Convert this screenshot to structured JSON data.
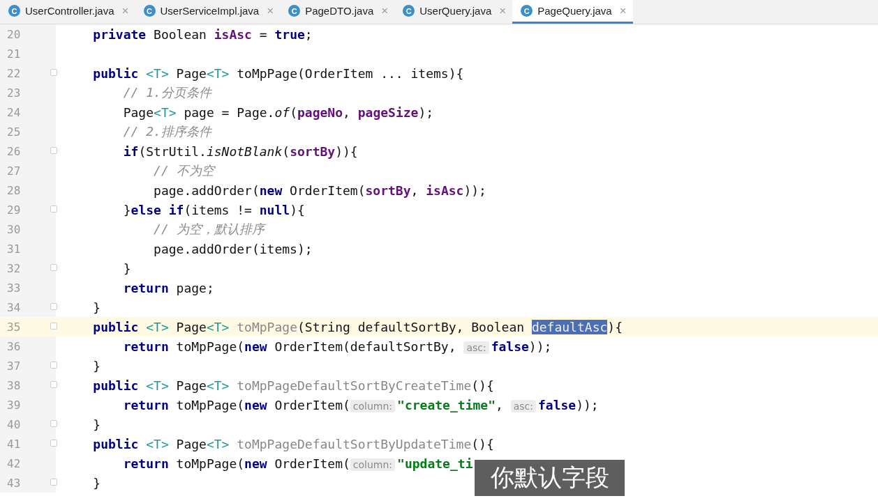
{
  "tabs": [
    {
      "icon": "C",
      "label": "UserController.java",
      "close": "×",
      "selected": false
    },
    {
      "icon": "C",
      "label": "UserServiceImpl.java",
      "close": "×",
      "selected": false
    },
    {
      "icon": "C",
      "label": "PageDTO.java",
      "close": "×",
      "selected": false
    },
    {
      "icon": "C",
      "label": "UserQuery.java",
      "close": "×",
      "selected": false
    },
    {
      "icon": "C",
      "label": "PageQuery.java",
      "close": "×",
      "selected": true
    }
  ],
  "lines": [
    {
      "number": "20",
      "fold": false,
      "current": false,
      "tokens": [
        {
          "kind": "kw",
          "text": "    private"
        },
        {
          "kind": "plain",
          "text": " Boolean "
        },
        {
          "kind": "field",
          "text": "isAsc"
        },
        {
          "kind": "plain",
          "text": " = "
        },
        {
          "kind": "kw",
          "text": "true"
        },
        {
          "kind": "plain",
          "text": ";"
        }
      ]
    },
    {
      "number": "21",
      "fold": false,
      "current": false
    },
    {
      "number": "22",
      "fold": true,
      "current": false,
      "tokens": [
        {
          "kind": "kw",
          "text": "    public"
        },
        {
          "kind": "tparam",
          "text": " <T>"
        },
        {
          "kind": "plain",
          "text": " Page"
        },
        {
          "kind": "tparam",
          "text": "<T>"
        },
        {
          "kind": "plain",
          "text": " toMpPage(OrderItem ... items){"
        }
      ]
    },
    {
      "number": "23",
      "fold": false,
      "current": false,
      "tokens": [
        {
          "kind": "comment",
          "text": "        // 1.分页条件"
        }
      ]
    },
    {
      "number": "24",
      "fold": false,
      "current": false,
      "tokens": [
        {
          "kind": "plain",
          "text": "        Page"
        },
        {
          "kind": "tparam",
          "text": "<T>"
        },
        {
          "kind": "plain",
          "text": " page = Page."
        },
        {
          "kind": "static",
          "text": "of"
        },
        {
          "kind": "plain",
          "text": "("
        },
        {
          "kind": "field",
          "text": "pageNo"
        },
        {
          "kind": "plain",
          "text": ", "
        },
        {
          "kind": "field",
          "text": "pageSize"
        },
        {
          "kind": "plain",
          "text": ");"
        }
      ]
    },
    {
      "number": "25",
      "fold": false,
      "current": false,
      "tokens": [
        {
          "kind": "comment",
          "text": "        // 2.排序条件"
        }
      ]
    },
    {
      "number": "26",
      "fold": true,
      "current": false,
      "tokens": [
        {
          "kind": "kw",
          "text": "        if"
        },
        {
          "kind": "plain",
          "text": "(StrUtil."
        },
        {
          "kind": "static",
          "text": "isNotBlank"
        },
        {
          "kind": "plain",
          "text": "("
        },
        {
          "kind": "field",
          "text": "sortBy"
        },
        {
          "kind": "plain",
          "text": ")){"
        }
      ]
    },
    {
      "number": "27",
      "fold": false,
      "current": false,
      "tokens": [
        {
          "kind": "comment",
          "text": "            // 不为空"
        }
      ]
    },
    {
      "number": "28",
      "fold": false,
      "current": false,
      "tokens": [
        {
          "kind": "plain",
          "text": "            page.addOrder("
        },
        {
          "kind": "kw",
          "text": "new"
        },
        {
          "kind": "plain",
          "text": " OrderItem("
        },
        {
          "kind": "field",
          "text": "sortBy"
        },
        {
          "kind": "plain",
          "text": ", "
        },
        {
          "kind": "field",
          "text": "isAsc"
        },
        {
          "kind": "plain",
          "text": "));"
        }
      ]
    },
    {
      "number": "29",
      "fold": true,
      "current": false,
      "tokens": [
        {
          "kind": "plain",
          "text": "        }"
        },
        {
          "kind": "kw",
          "text": "else if"
        },
        {
          "kind": "plain",
          "text": "(items != "
        },
        {
          "kind": "kw",
          "text": "null"
        },
        {
          "kind": "plain",
          "text": "){"
        }
      ]
    },
    {
      "number": "30",
      "fold": false,
      "current": false,
      "tokens": [
        {
          "kind": "comment",
          "text": "            // 为空，默认排序"
        }
      ]
    },
    {
      "number": "31",
      "fold": false,
      "current": false,
      "tokens": [
        {
          "kind": "plain",
          "text": "            page.addOrder(items);"
        }
      ]
    },
    {
      "number": "32",
      "fold": true,
      "current": false,
      "tokens": [
        {
          "kind": "plain",
          "text": "        }"
        }
      ]
    },
    {
      "number": "33",
      "fold": false,
      "current": false,
      "tokens": [
        {
          "kind": "kw",
          "text": "        return"
        },
        {
          "kind": "plain",
          "text": " page;"
        }
      ]
    },
    {
      "number": "34",
      "fold": true,
      "current": false,
      "tokens": [
        {
          "kind": "plain",
          "text": "    }"
        }
      ]
    },
    {
      "number": "35",
      "fold": true,
      "current": true,
      "tokens": [
        {
          "kind": "kw",
          "text": "    public"
        },
        {
          "kind": "tparam",
          "text": " <T>"
        },
        {
          "kind": "plain",
          "text": " Page"
        },
        {
          "kind": "tparam",
          "text": "<T>"
        },
        {
          "kind": "unused",
          "text": " toMpPage"
        },
        {
          "kind": "plain",
          "text": "(String defaultSortBy, Boolean "
        },
        {
          "kind": "sel",
          "text": "defaultAsc"
        },
        {
          "kind": "plain",
          "text": "){"
        }
      ]
    },
    {
      "number": "36",
      "fold": false,
      "current": false,
      "tokens": [
        {
          "kind": "kw",
          "text": "        return"
        },
        {
          "kind": "plain",
          "text": " toMpPage("
        },
        {
          "kind": "kw",
          "text": "new"
        },
        {
          "kind": "plain",
          "text": " OrderItem(defaultSortBy, "
        },
        {
          "kind": "hint",
          "text": "asc:"
        },
        {
          "kind": "kw",
          "text": "false"
        },
        {
          "kind": "plain",
          "text": "));"
        }
      ]
    },
    {
      "number": "37",
      "fold": true,
      "current": false,
      "tokens": [
        {
          "kind": "plain",
          "text": "    }"
        }
      ]
    },
    {
      "number": "38",
      "fold": true,
      "current": false,
      "tokens": [
        {
          "kind": "kw",
          "text": "    public"
        },
        {
          "kind": "tparam",
          "text": " <T>"
        },
        {
          "kind": "plain",
          "text": " Page"
        },
        {
          "kind": "tparam",
          "text": "<T>"
        },
        {
          "kind": "unused",
          "text": " toMpPageDefaultSortByCreateTime"
        },
        {
          "kind": "plain",
          "text": "(){"
        }
      ]
    },
    {
      "number": "39",
      "fold": false,
      "current": false,
      "tokens": [
        {
          "kind": "kw",
          "text": "        return"
        },
        {
          "kind": "plain",
          "text": " toMpPage("
        },
        {
          "kind": "kw",
          "text": "new"
        },
        {
          "kind": "plain",
          "text": " OrderItem("
        },
        {
          "kind": "hint",
          "text": "column:"
        },
        {
          "kind": "str",
          "text": "\"create_time\""
        },
        {
          "kind": "plain",
          "text": ", "
        },
        {
          "kind": "hint",
          "text": "asc:"
        },
        {
          "kind": "kw",
          "text": "false"
        },
        {
          "kind": "plain",
          "text": "));"
        }
      ]
    },
    {
      "number": "40",
      "fold": true,
      "current": false,
      "tokens": [
        {
          "kind": "plain",
          "text": "    }"
        }
      ]
    },
    {
      "number": "41",
      "fold": true,
      "current": false,
      "tokens": [
        {
          "kind": "kw",
          "text": "    public"
        },
        {
          "kind": "tparam",
          "text": " <T>"
        },
        {
          "kind": "plain",
          "text": " Page"
        },
        {
          "kind": "tparam",
          "text": "<T>"
        },
        {
          "kind": "unused",
          "text": " toMpPageDefaultSortByUpdateTime"
        },
        {
          "kind": "plain",
          "text": "(){"
        }
      ]
    },
    {
      "number": "42",
      "fold": false,
      "current": false,
      "tokens": [
        {
          "kind": "kw",
          "text": "        return"
        },
        {
          "kind": "plain",
          "text": " toMpPage("
        },
        {
          "kind": "kw",
          "text": "new"
        },
        {
          "kind": "plain",
          "text": " OrderItem("
        },
        {
          "kind": "hint",
          "text": "column:"
        },
        {
          "kind": "str",
          "text": "\"update_ti"
        }
      ]
    },
    {
      "number": "43",
      "fold": true,
      "current": false,
      "tokens": [
        {
          "kind": "plain",
          "text": "    }"
        }
      ]
    }
  ],
  "subtitle": "你默认字段"
}
